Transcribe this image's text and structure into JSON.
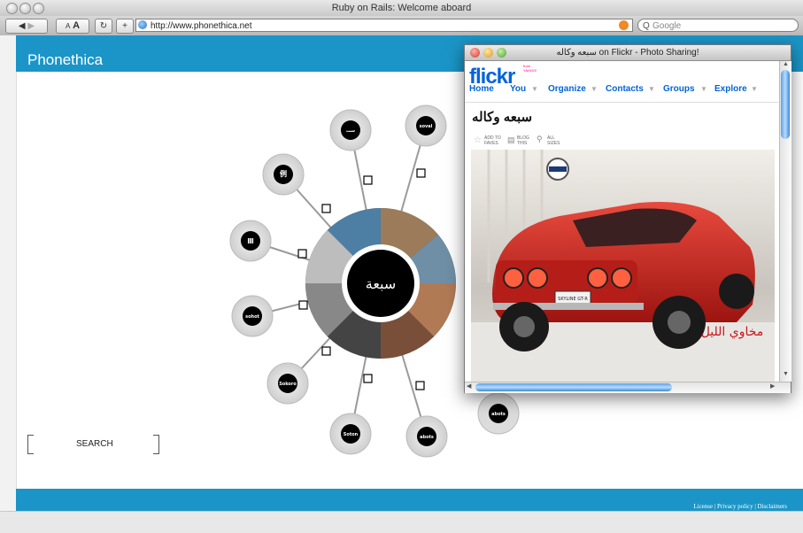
{
  "browser": {
    "title": "Ruby on Rails: Welcome aboard",
    "url": "http://www.phonethica.net",
    "search_placeholder": "Google",
    "text_small": "A",
    "text_large": "A",
    "search_prefix": "Q"
  },
  "site": {
    "brand": "Phonethica",
    "search_label": "SEARCH",
    "footer_links": "License | Privacy policy | Disclaimers",
    "center_word": "سبعة",
    "nodes": [
      {
        "label": "ست"
      },
      {
        "label": "soval"
      },
      {
        "label": "例"
      },
      {
        "label": "Ⅲ"
      },
      {
        "label": "sohot"
      },
      {
        "label": "Sokoro"
      },
      {
        "label": "Soton"
      },
      {
        "label": "abots"
      },
      {
        "label": "abots"
      }
    ]
  },
  "flickr": {
    "window_title": "سبعه وكاله on Flickr - Photo Sharing!",
    "logo_main": "flickr",
    "logo_sub": "from\nYAHOO!",
    "nav": [
      {
        "label": "Home"
      },
      {
        "label": "You"
      },
      {
        "label": "Organize"
      },
      {
        "label": "Contacts"
      },
      {
        "label": "Groups"
      },
      {
        "label": "Explore"
      }
    ],
    "photo_title": "سبعه وكاله",
    "actions": [
      {
        "label": "ADD TO FAVES"
      },
      {
        "label": "BLOG THIS"
      },
      {
        "label": "ALL SIZES"
      }
    ],
    "photo_signature": "مخاوي الليل",
    "plate_text": "SKYLINE GT-R"
  },
  "colors": {
    "accent": "#1b95c7",
    "flickr_blue": "#0063dc",
    "flickr_pink": "#ff0084"
  }
}
